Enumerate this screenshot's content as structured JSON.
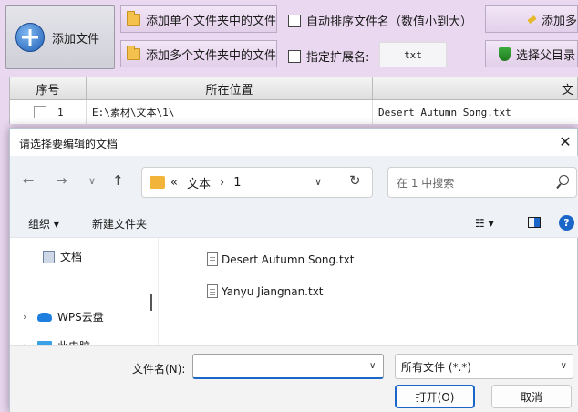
{
  "app": {
    "add_file_label": "添加文件",
    "add_single_folder_label": "添加单个文件夹中的文件",
    "add_multi_folder_label": "添加多个文件夹中的文件",
    "auto_sort_label": "自动排序文件名（数值小到大）",
    "ext_label": "指定扩展名:",
    "ext_value": "txt",
    "add_more_label": "添加多",
    "select_parent_label": "选择父目录",
    "grid": {
      "headers": [
        "序号",
        "所在位置",
        "文"
      ],
      "rows": [
        {
          "index": "1",
          "location": "E:\\素材\\文本\\1\\",
          "name": "Desert Autumn Song.txt"
        }
      ]
    }
  },
  "dialog": {
    "title": "请选择要编辑的文档",
    "close_glyph": "✕",
    "nav": {
      "back": "←",
      "forward": "→",
      "recent": "∨",
      "up": "↑",
      "path_prefix": "«",
      "path_segments": [
        "文本",
        "1"
      ],
      "path_sep": "›",
      "dropdown": "∨",
      "refresh": "↻",
      "search_placeholder": "在 1 中搜索"
    },
    "commands": {
      "organize": "组织 ▾",
      "new_folder": "新建文件夹",
      "view": "☷ ▾",
      "help": "?"
    },
    "sidebar": [
      {
        "label": "文档",
        "chevron": ""
      },
      {
        "label": "WPS云盘",
        "chevron": "›"
      },
      {
        "label": "此电脑",
        "chevron": "›"
      }
    ],
    "files": [
      "Desert Autumn Song.txt",
      "Yanyu Jiangnan.txt"
    ],
    "filename_label": "文件名(N):",
    "filename_value": "",
    "filetype": "所有文件 (*.*)",
    "dd_glyph": "∨",
    "open_label": "打开(O)",
    "cancel_label": "取消"
  }
}
